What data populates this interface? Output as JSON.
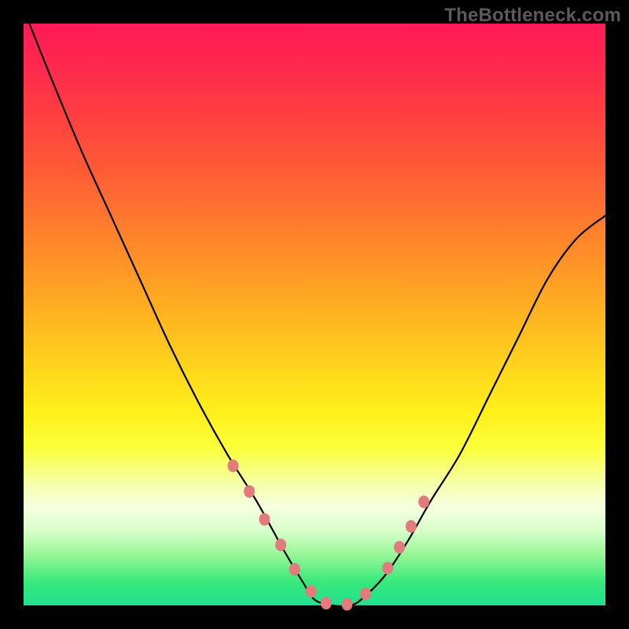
{
  "watermark": "TheBottleneck.com",
  "colors": {
    "curve_stroke": "#000000",
    "marker_fill": "#e27c7c",
    "black_border": "#000000"
  },
  "chart_data": {
    "type": "line",
    "title": "",
    "xlabel": "",
    "ylabel": "",
    "xlim": [
      0,
      100
    ],
    "ylim": [
      0,
      100
    ],
    "series": [
      {
        "name": "curve",
        "x": [
          1,
          5,
          10,
          15,
          20,
          25,
          30,
          35,
          40,
          45,
          48,
          50,
          53,
          56,
          58,
          62,
          66,
          70,
          75,
          80,
          85,
          90,
          95,
          100
        ],
        "values": [
          100,
          90,
          78,
          67,
          56,
          45,
          35,
          26,
          18,
          9,
          4,
          1,
          0,
          0,
          1,
          5,
          11,
          18,
          26,
          36,
          46,
          56,
          63,
          67
        ]
      }
    ],
    "markers": {
      "name": "highlight_points",
      "radius_px": 7,
      "x": [
        36.0,
        38.8,
        41.4,
        44.2,
        46.6,
        49.4,
        52.0,
        55.6,
        58.8,
        62.6,
        64.6,
        66.6,
        68.8
      ],
      "values": [
        24.0,
        19.6,
        14.8,
        10.4,
        6.2,
        2.4,
        0.4,
        0.2,
        2.0,
        6.4,
        10.0,
        13.6,
        17.8
      ]
    }
  }
}
